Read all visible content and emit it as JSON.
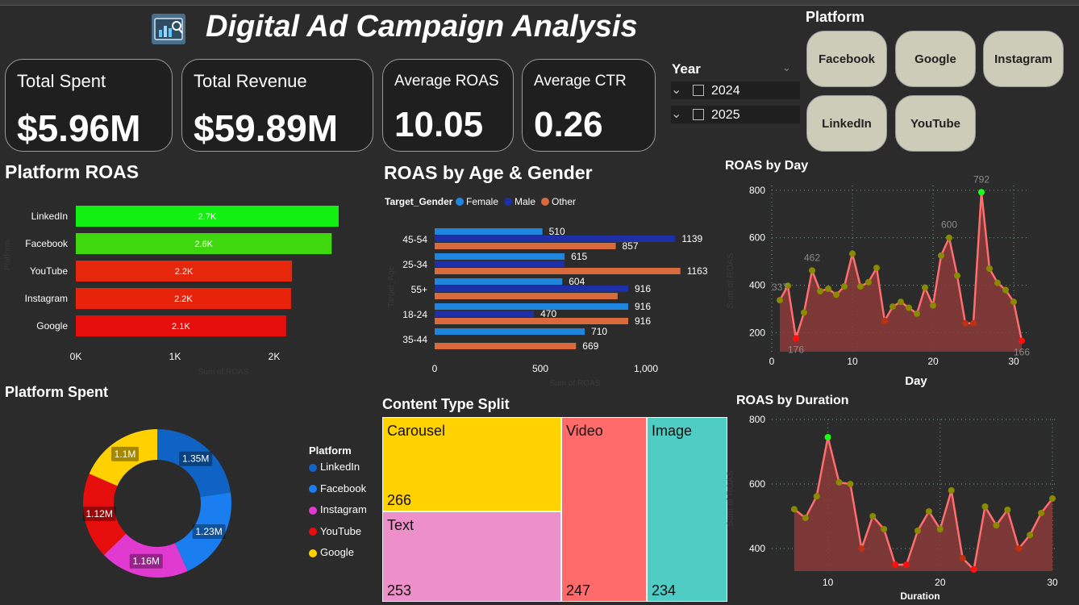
{
  "header": {
    "title": "Digital Ad Campaign Analysis",
    "logo_icon": "dashboard-logo-icon"
  },
  "kpis": [
    {
      "label": "Total Spent",
      "value": "$5.96M"
    },
    {
      "label": "Total Revenue",
      "value": "$59.89M"
    },
    {
      "label": "Average ROAS",
      "value": "10.05"
    },
    {
      "label": "Average CTR",
      "value": "0.26"
    }
  ],
  "year_filter": {
    "title": "Year",
    "options": [
      "2024",
      "2025"
    ]
  },
  "platform_filter": {
    "title": "Platform",
    "buttons": [
      "Facebook",
      "Google",
      "Instagram",
      "LinkedIn",
      "YouTube"
    ]
  },
  "platform_roas": {
    "title": "Platform ROAS",
    "xlabel": "Sum of ROAS",
    "ylabel": "Platform",
    "ticks": [
      "0K",
      "1K",
      "2K"
    ]
  },
  "age_gender": {
    "title": "ROAS by Age & Gender",
    "legend_title": "Target_Gender",
    "xlabel": "Sum of ROAS",
    "ylabel": "Target_Age",
    "ticks": [
      "0",
      "500",
      "1,000"
    ]
  },
  "roas_by_day": {
    "title": "ROAS by Day",
    "xlabel": "Day",
    "ylabel": "Sum of ROAS"
  },
  "platform_spent": {
    "title": "Platform Spent",
    "legend_title": "Platform"
  },
  "content_split": {
    "title": "Content Type Split",
    "cells": [
      {
        "label": "Carousel",
        "value": "266",
        "color": "#ffd200"
      },
      {
        "label": "Text",
        "value": "253",
        "color": "#ed8fc8"
      },
      {
        "label": "Video",
        "value": "247",
        "color": "#ff6b6b"
      },
      {
        "label": "Image",
        "value": "234",
        "color": "#4fccc4"
      }
    ]
  },
  "roas_by_duration": {
    "title": "ROAS by Duration",
    "xlabel": "Duration",
    "ylabel": "Sum of ROAS"
  },
  "chart_data": [
    {
      "type": "bar",
      "id": "platform_roas",
      "categories": [
        "LinkedIn",
        "Facebook",
        "YouTube",
        "Instagram",
        "Google"
      ],
      "values": [
        2650,
        2580,
        2180,
        2170,
        2120
      ],
      "labels": [
        "2.7K",
        "2.6K",
        "2.2K",
        "2.2K",
        "2.1K"
      ],
      "colors": [
        "#11f011",
        "#3fd80e",
        "#e6270b",
        "#e7230b",
        "#e70f0b"
      ],
      "xlim": [
        0,
        2600
      ]
    },
    {
      "type": "bar",
      "id": "age_gender",
      "categories": [
        "45-54",
        "25-34",
        "55+",
        "18-24",
        "35-44"
      ],
      "series": [
        {
          "name": "Female",
          "color": "#1f86e0",
          "values": [
            510,
            615,
            604,
            916,
            710
          ]
        },
        {
          "name": "Male",
          "color": "#1c2fa6",
          "values": [
            1139,
            615,
            916,
            470,
            null
          ]
        },
        {
          "name": "Other",
          "color": "#d86a3b",
          "values": [
            857,
            1163,
            866,
            916,
            669
          ]
        }
      ],
      "labels": [
        [
          "510",
          "1139",
          "857"
        ],
        [
          "615",
          "",
          "1163"
        ],
        [
          "604",
          "916",
          ""
        ],
        [
          "916",
          "470",
          "916"
        ],
        [
          "710",
          "",
          "669"
        ]
      ],
      "xlim": [
        0,
        1200
      ]
    },
    {
      "type": "area",
      "id": "roas_by_day",
      "x": [
        1,
        2,
        3,
        4,
        5,
        6,
        7,
        8,
        9,
        10,
        11,
        12,
        13,
        14,
        15,
        16,
        17,
        18,
        19,
        20,
        21,
        22,
        23,
        24,
        25,
        26,
        27,
        28,
        29,
        30,
        31
      ],
      "values": [
        337,
        398,
        176,
        285,
        462,
        375,
        385,
        360,
        395,
        533,
        395,
        413,
        473,
        250,
        310,
        330,
        305,
        280,
        390,
        315,
        525,
        600,
        440,
        240,
        240,
        792,
        470,
        410,
        380,
        330,
        166
      ],
      "point_labels": {
        "1": "337",
        "3": "176",
        "5": "462",
        "22": "600",
        "26": "792",
        "31": "166"
      },
      "yticks": [
        200,
        400,
        600,
        800
      ],
      "xticks": [
        0,
        10,
        20,
        30
      ],
      "ylim": [
        120,
        820
      ],
      "xlim": [
        0,
        32
      ]
    },
    {
      "type": "pie",
      "id": "platform_spent",
      "categories": [
        "LinkedIn",
        "Facebook",
        "Instagram",
        "YouTube",
        "Google"
      ],
      "values": [
        1.35,
        1.23,
        1.16,
        1.12,
        1.1
      ],
      "labels": [
        "1.35M",
        "1.23M",
        "1.16M",
        "1.12M",
        "1.1M"
      ],
      "colors": [
        "#0f63c4",
        "#1a7ef0",
        "#e13ad0",
        "#e60d0d",
        "#ffd100"
      ]
    },
    {
      "type": "area",
      "id": "roas_by_duration",
      "x": [
        7,
        8,
        9,
        10,
        11,
        12,
        13,
        14,
        15,
        16,
        17,
        18,
        19,
        20,
        21,
        22,
        23,
        24,
        25,
        26,
        27,
        28,
        29,
        30
      ],
      "values": [
        522,
        495,
        562,
        745,
        605,
        600,
        400,
        500,
        460,
        350,
        350,
        455,
        515,
        460,
        580,
        370,
        335,
        530,
        472,
        520,
        400,
        442,
        510,
        555
      ],
      "yticks": [
        400,
        600,
        800
      ],
      "xticks": [
        10,
        20,
        30
      ],
      "ylim": [
        330,
        800
      ],
      "xlim": [
        5,
        30.5
      ]
    }
  ]
}
